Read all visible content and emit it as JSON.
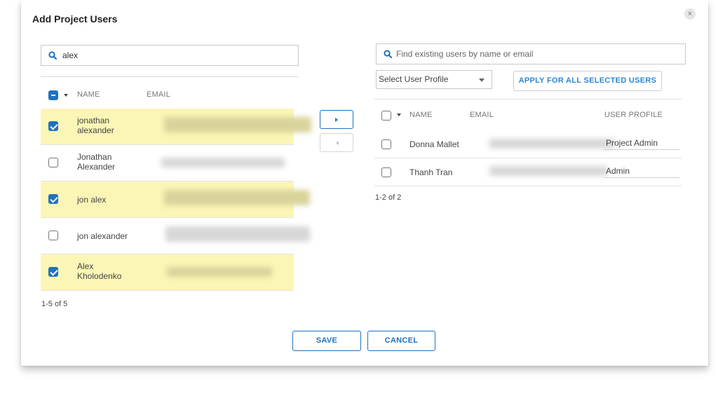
{
  "dialog": {
    "title": "Add Project Users",
    "close_icon": "×"
  },
  "left": {
    "search": {
      "value": "alex",
      "placeholder": ""
    },
    "columns": {
      "name": "NAME",
      "email": "EMAIL"
    },
    "rows": [
      {
        "name_line1": "jonathan",
        "name_line2": "alexander",
        "selected": true
      },
      {
        "name_line1": "Jonathan",
        "name_line2": "Alexander",
        "selected": false
      },
      {
        "name_line1": "jon alex",
        "name_line2": "",
        "selected": true
      },
      {
        "name_line1": "jon alexander",
        "name_line2": "",
        "selected": false
      },
      {
        "name_line1": "Alex",
        "name_line2": "Kholodenko",
        "selected": true
      }
    ],
    "count": "1-5 of 5"
  },
  "transfer": {
    "add_icon": "chevron-right-icon",
    "remove_icon": "chevron-left-icon"
  },
  "right": {
    "search": {
      "value": "",
      "placeholder": "Find existing users by name or email"
    },
    "profile_select": {
      "selected": "Select User Profile"
    },
    "apply_label": "APPLY FOR ALL SELECTED USERS",
    "columns": {
      "name": "NAME",
      "email": "EMAIL",
      "profile": "USER PROFILE"
    },
    "rows": [
      {
        "name": "Donna Mallet",
        "profile": "Project Admin"
      },
      {
        "name": "Thanh Tran",
        "profile": "Admin"
      }
    ],
    "count": "1-2 of 2"
  },
  "footer": {
    "save_label": "SAVE",
    "cancel_label": "CANCEL"
  },
  "colors": {
    "accent": "#1d72c2",
    "selected_row": "#fbf6b6"
  }
}
